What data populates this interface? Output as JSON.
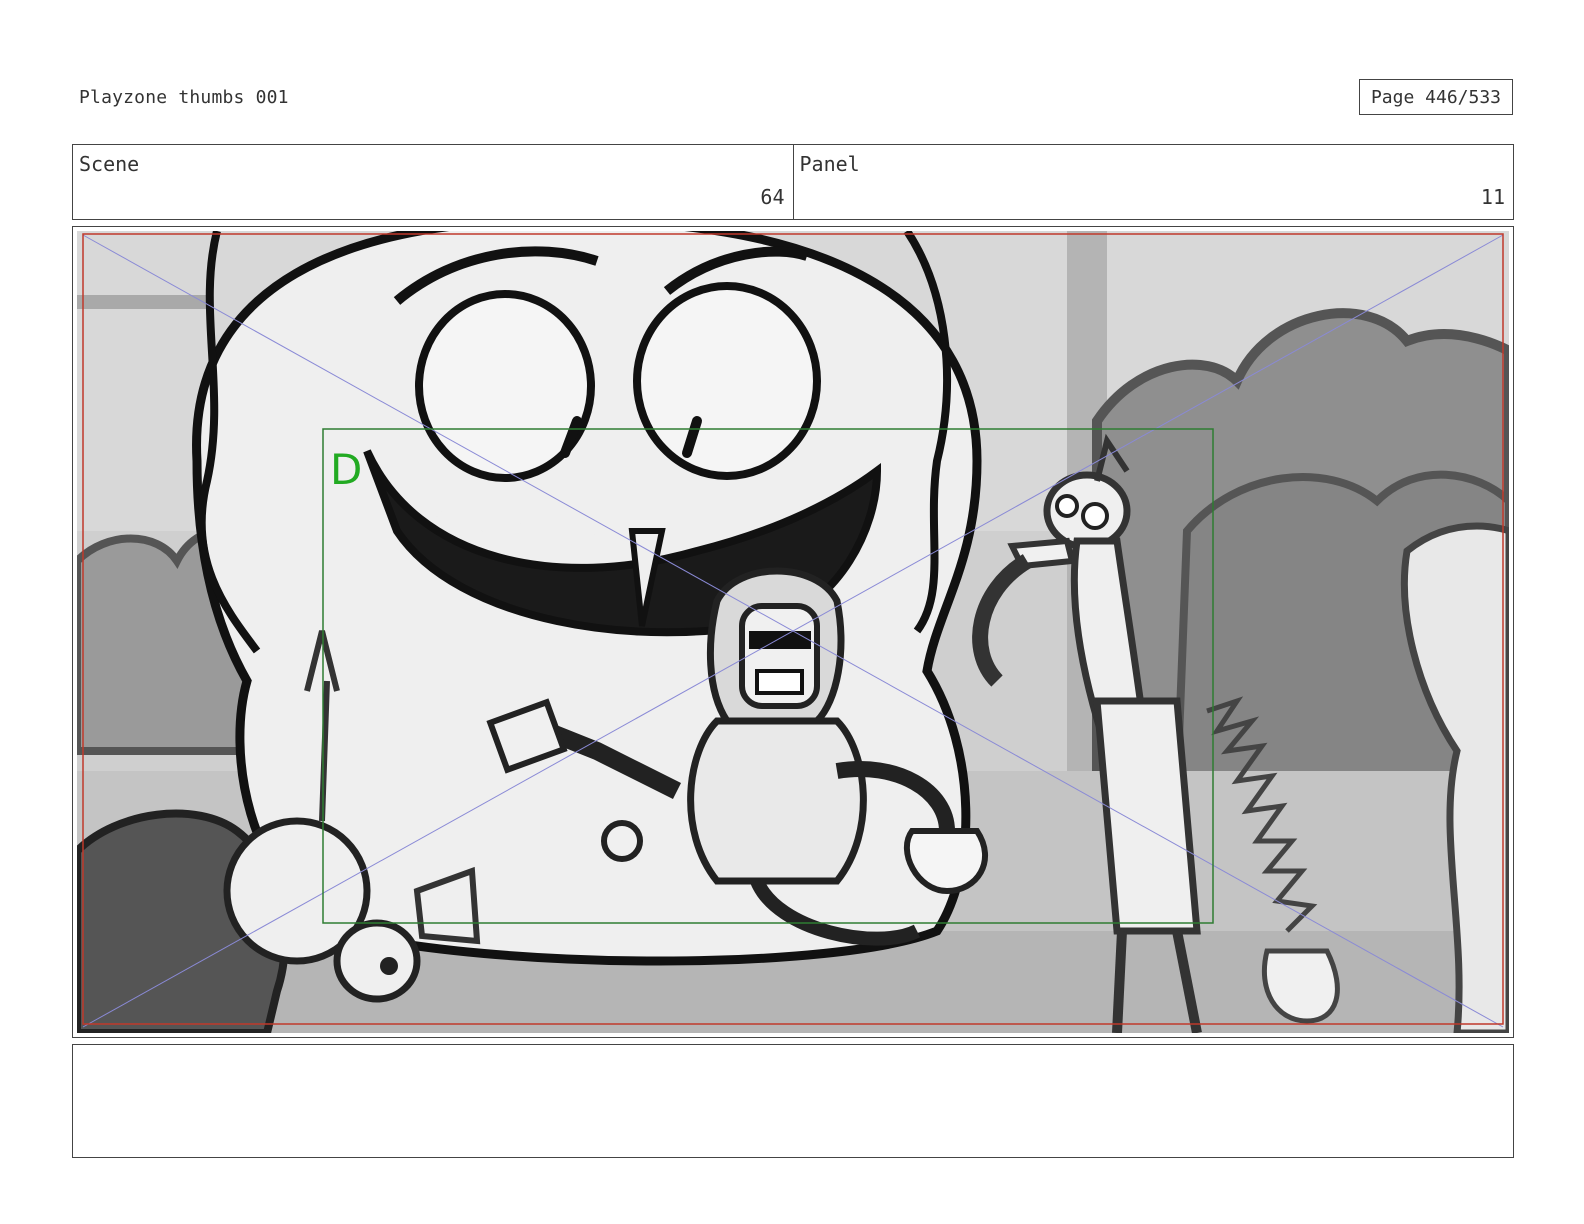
{
  "header": {
    "title": "Playzone thumbs 001",
    "page_label": "Page 446/533"
  },
  "scene": {
    "label": "Scene",
    "value": "64"
  },
  "panel": {
    "label": "Panel",
    "value": "11"
  },
  "frame": {
    "field_marker": "D",
    "colors": {
      "safe_area": "#c0392b",
      "field_guide": "#2e7d32",
      "marker_text": "#22aa22",
      "diagonals": "#8a8ad6"
    }
  },
  "notes": {
    "text": ""
  }
}
